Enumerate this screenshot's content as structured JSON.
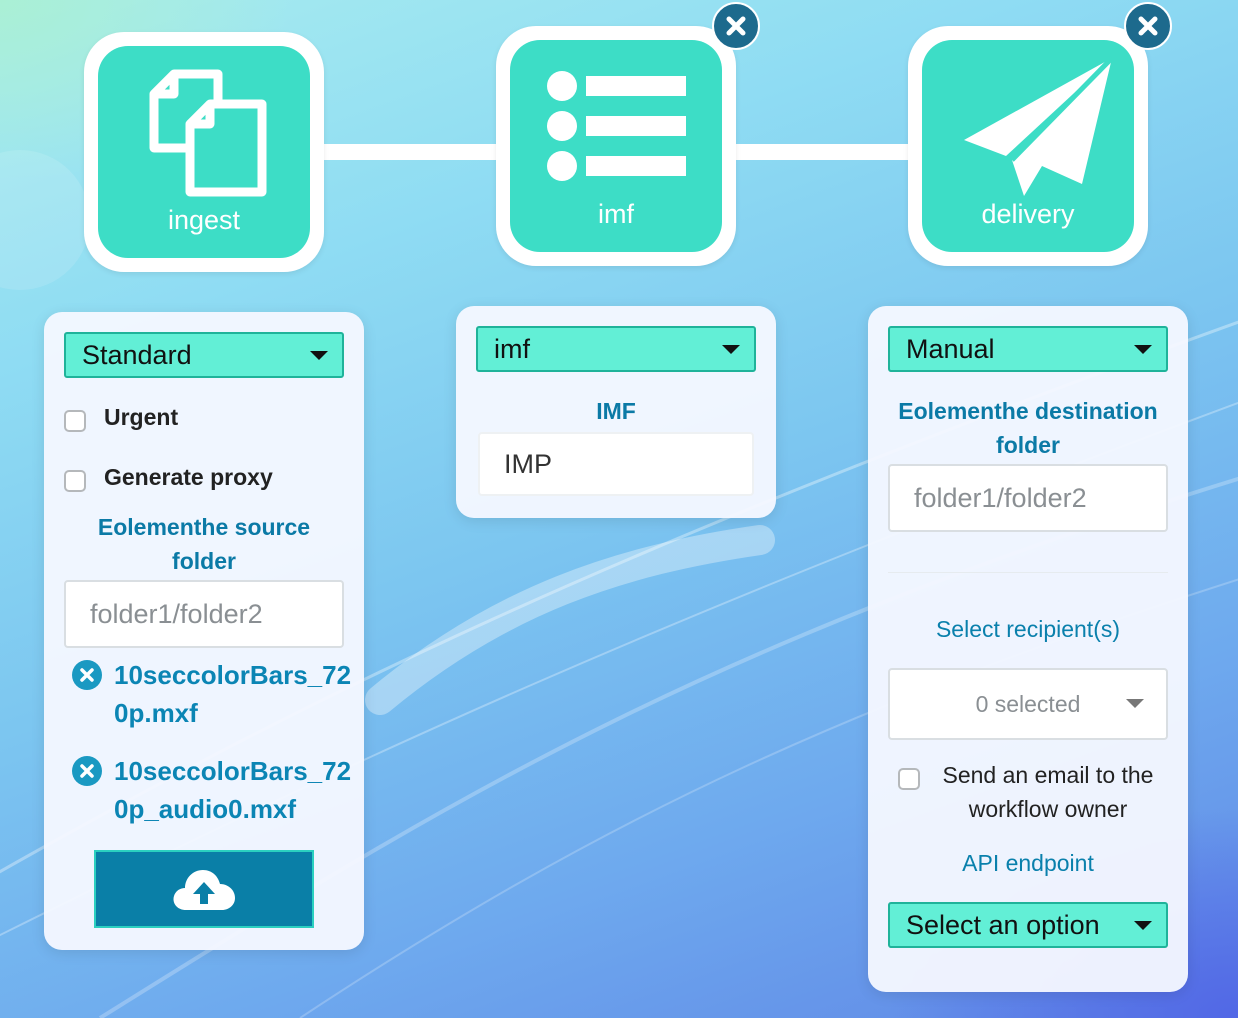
{
  "workflow": {
    "nodes": [
      {
        "label": "ingest",
        "icon": "files-icon"
      },
      {
        "label": "imf",
        "icon": "list-icon"
      },
      {
        "label": "delivery",
        "icon": "paper-plane-icon"
      }
    ],
    "accent_color": "#3dddc6"
  },
  "ingest_panel": {
    "mode_select": "Standard",
    "urgent_label": "Urgent",
    "urgent_checked": false,
    "proxy_label": "Generate proxy",
    "proxy_checked": false,
    "source_folder_label": "Eolementhe source folder",
    "source_folder_placeholder": "folder1/folder2",
    "files": [
      {
        "name": "10seccolorBars_720p.mxf"
      },
      {
        "name": "10seccolorBars_720p_audio0.mxf"
      }
    ],
    "upload_icon": "cloud-upload-icon"
  },
  "imf_panel": {
    "type_select": "imf",
    "field_label": "IMF",
    "field_value": "IMP"
  },
  "delivery_panel": {
    "mode_select": "Manual",
    "dest_folder_label": "Eolementhe destination folder",
    "dest_folder_placeholder": "folder1/folder2",
    "recipients_label": "Select recipient(s)",
    "recipients_value": "0 selected",
    "email_owner_label": "Send an email to the workflow owner",
    "email_owner_checked": false,
    "api_label": "API endpoint",
    "api_select": "Select an option"
  }
}
